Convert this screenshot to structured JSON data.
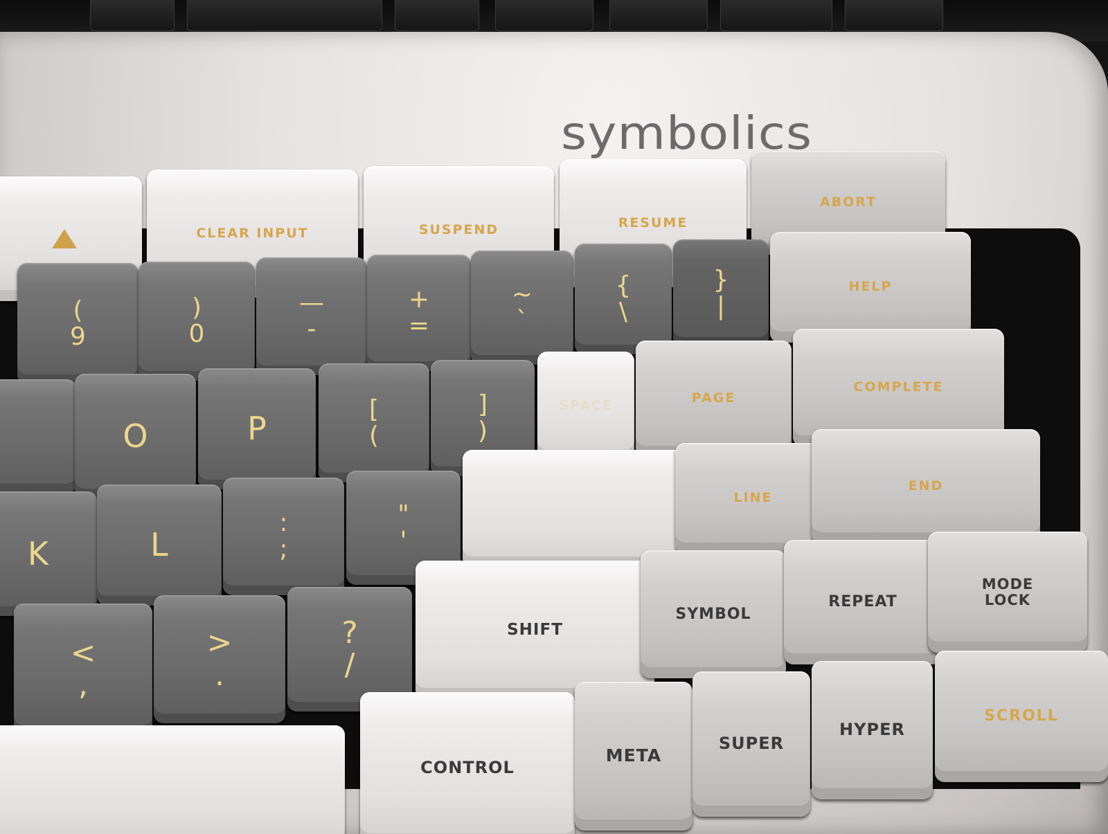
{
  "brand": {
    "logo_text": "symbolics"
  },
  "colors": {
    "housing": "#e6e2e2",
    "dark_key": "#6a6a6a",
    "light_key": "#efecec",
    "legend_gold": "#d7a64a",
    "legend_dark": "#3a3a3a"
  },
  "keys": {
    "up_arrow": {
      "icon": "triangle-up-icon"
    },
    "clear_input": "CLEAR INPUT",
    "suspend": "SUSPEND",
    "resume": "RESUME",
    "abort": "ABORT",
    "nine": "(\n9",
    "zero": ")\n0",
    "minus": "—\n-",
    "equals": "+\n=",
    "tilde": "~\n`",
    "brace_left": "{\n\\",
    "brace_right": "}\n|",
    "help": "HELP",
    "o": "O",
    "p": "P",
    "bracket_left": "[\n(",
    "bracket_right": "]\n)",
    "back_space": "SPACE",
    "page": "PAGE",
    "complete": "COMPLETE",
    "k": "K",
    "l": "L",
    "semicolon": ":\n;",
    "quote": "\"\n'",
    "return": "",
    "line": "LINE",
    "end": "END",
    "comma": "<\n,",
    "period": ">\n.",
    "slash": "?\n/",
    "shift": "SHIFT",
    "symbol": "SYMBOL",
    "repeat": "REPEAT",
    "mode_lock": "MODE\nLOCK",
    "control": "CONTROL",
    "meta": "META",
    "super": "SUPER",
    "hyper": "HYPER",
    "scroll": "SCROLL"
  }
}
